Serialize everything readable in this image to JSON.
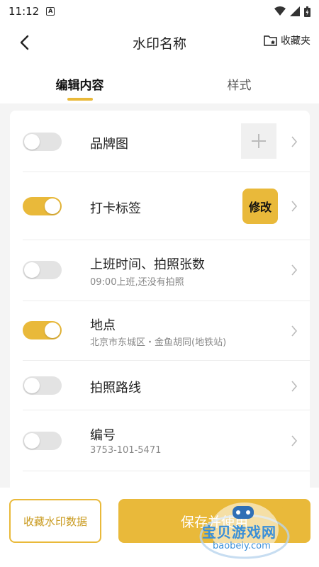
{
  "status": {
    "time": "11:12"
  },
  "nav": {
    "title": "水印名称",
    "favorites_label": "收藏夹"
  },
  "tabs": [
    {
      "label": "编辑内容",
      "active": true
    },
    {
      "label": "样式",
      "active": false
    }
  ],
  "rows": [
    {
      "title": "品牌图",
      "enabled": false,
      "action": "add"
    },
    {
      "title": "打卡标签",
      "enabled": true,
      "action_label": "修改"
    },
    {
      "title": "上班时间、拍照张数",
      "subtitle": "09:00上班,还没有拍照",
      "enabled": false
    },
    {
      "title": "地点",
      "subtitle": "北京市东城区・金鱼胡同(地铁站)",
      "enabled": true
    },
    {
      "title": "拍照路线",
      "enabled": false
    },
    {
      "title": "编号",
      "subtitle": "3753-101-5471",
      "enabled": false
    }
  ],
  "bottom": {
    "save_data_label": "收藏水印数据",
    "save_use_label": "保存并使用"
  },
  "watermark": {
    "text": "宝贝游戏网",
    "url": "baobeiy.com"
  },
  "colors": {
    "accent": "#e9b93a",
    "toggle_off": "#e3e3e3"
  }
}
